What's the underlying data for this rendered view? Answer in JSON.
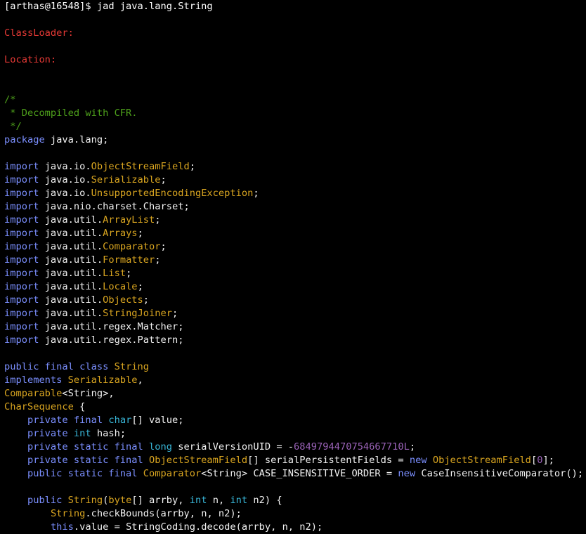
{
  "terminal": {
    "prompt": "[arthas@16548]$ jad java.lang.String",
    "classloader_label": "ClassLoader:",
    "location_label": "Location:",
    "comment_open": "/*",
    "comment_body": " * Decompiled with CFR.",
    "comment_close": " */",
    "package_kw": "package",
    "package_name": " java.lang;",
    "imports": [
      {
        "kw": "import",
        "prefix": " java.io.",
        "cls": "ObjectStreamField",
        "suffix": ";"
      },
      {
        "kw": "import",
        "prefix": " java.io.",
        "cls": "Serializable",
        "suffix": ";"
      },
      {
        "kw": "import",
        "prefix": " java.io.",
        "cls": "UnsupportedEncodingException",
        "suffix": ";"
      },
      {
        "kw": "import",
        "prefix": " java.nio.charset.Charset;",
        "cls": "",
        "suffix": ""
      },
      {
        "kw": "import",
        "prefix": " java.util.",
        "cls": "ArrayList",
        "suffix": ";"
      },
      {
        "kw": "import",
        "prefix": " java.util.",
        "cls": "Arrays",
        "suffix": ";"
      },
      {
        "kw": "import",
        "prefix": " java.util.",
        "cls": "Comparator",
        "suffix": ";"
      },
      {
        "kw": "import",
        "prefix": " java.util.",
        "cls": "Formatter",
        "suffix": ";"
      },
      {
        "kw": "import",
        "prefix": " java.util.",
        "cls": "List",
        "suffix": ";"
      },
      {
        "kw": "import",
        "prefix": " java.util.",
        "cls": "Locale",
        "suffix": ";"
      },
      {
        "kw": "import",
        "prefix": " java.util.",
        "cls": "Objects",
        "suffix": ";"
      },
      {
        "kw": "import",
        "prefix": " java.util.",
        "cls": "StringJoiner",
        "suffix": ";"
      },
      {
        "kw": "import",
        "prefix": " java.util.regex.Matcher;",
        "cls": "",
        "suffix": ""
      },
      {
        "kw": "import",
        "prefix": " java.util.regex.Pattern;",
        "cls": "",
        "suffix": ""
      }
    ],
    "class_decl": {
      "mods": "public final class",
      "name": " String",
      "implements_kw": "implements",
      "iface1": " Serializable",
      "comma1": ",",
      "iface2": "Comparable",
      "iface2_generic": "<String>,",
      "iface3": "CharSequence",
      "brace": " {"
    },
    "fields": [
      {
        "mods": "    private final ",
        "type": "char",
        "rest": "[] value;",
        "rest_color": "plain"
      },
      {
        "mods": "    private ",
        "type": "int",
        "rest": " hash;",
        "rest_color": "plain"
      },
      {
        "mods": "    private static final ",
        "type": "long",
        "rest": " serialVersionUID = -",
        "num": "6849794470754667710L",
        "end": ";"
      },
      {
        "mods": "    private static final ",
        "type": "ObjectStreamField",
        "rest": "[] serialPersistentFields = ",
        "new_kw": "new",
        "type2": " ObjectStreamField",
        "bracket_open": "[",
        "num": "0",
        "end": "];"
      },
      {
        "mods": "    public static final ",
        "type": "Comparator",
        "rest": "<String> CASE_INSENSITIVE_ORDER = ",
        "new_kw": "new",
        "end": " CaseInsensitiveComparator();"
      }
    ],
    "ctor": {
      "mods": "    public ",
      "name": "String",
      "open": "(",
      "p1_type": "byte",
      "p1_rest": "[] arrby, ",
      "p2_type": "int",
      "p2_rest": " n, ",
      "p3_type": "int",
      "p3_rest": " n2) {"
    },
    "body": [
      {
        "indent": "        ",
        "type": "String",
        "rest": ".checkBounds(arrby, n, n2);"
      },
      {
        "indent": "        ",
        "type": "this",
        "rest": ".value = StringCoding.decode(arrby, n, n2);"
      }
    ]
  }
}
